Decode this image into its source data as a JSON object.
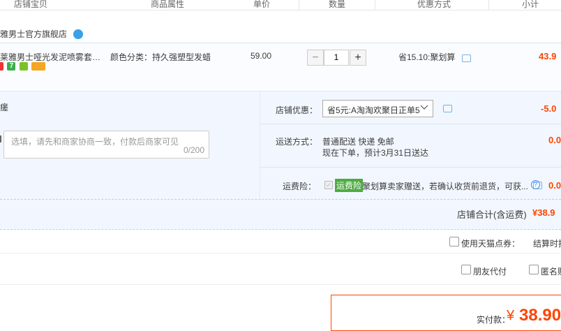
{
  "header": {
    "col_item": "店铺宝贝",
    "col_attr": "商品属性",
    "col_price": "单价",
    "col_qty": "数量",
    "col_promo": "优惠方式",
    "col_subtotal": "小计"
  },
  "shop": {
    "name": "雅男士官方旗舰店"
  },
  "item": {
    "title": "莱雅男士哑光发泥喷雾套装持...",
    "sku_label": "颜色分类：",
    "sku_value": "持久强塑型发蜡",
    "price": "59.00",
    "quantity": "1",
    "minus": "−",
    "plus": "+",
    "promo": "省15.10:聚划算",
    "subtotal": "43.9",
    "badges": [
      {
        "name": "badge-red-icon",
        "color": "#e33"
      },
      {
        "name": "badge-7-icon",
        "color": "#3cb04a",
        "text": "7"
      },
      {
        "name": "badge-green-icon",
        "color": "#7cc12a"
      },
      {
        "name": "badge-card-icon",
        "color": "#f5a623"
      }
    ]
  },
  "left_panel": {
    "label_fragment": "瘥",
    "message_placeholder": "选填，请先和商家协商一致，付款后商家可见",
    "message_counter": "0/200"
  },
  "shop_discount": {
    "label": "店铺优惠：",
    "selected": "省5元:A淘淘欢聚日正单5",
    "amount": "-5.0"
  },
  "shipping": {
    "label": "运送方式：",
    "method": "普通配送 快递 免邮",
    "eta": "现在下单，预计3月31日送达",
    "amount": "0.0"
  },
  "insurance": {
    "label": "运费险：",
    "tag": "运费险",
    "desc": "聚划算卖家赠送，若确认收货前退货，可获...",
    "amount": "0.0",
    "checkmark": "✓",
    "help": "?"
  },
  "summary": {
    "label": "店铺合计(含运费)",
    "amount": "¥38.9"
  },
  "options": {
    "tmall_points": "使用天猫点券：",
    "settle_fragment": "结算时抵",
    "friend_pay": "朋友代付",
    "anonymous": "匿名购"
  },
  "payment": {
    "label": "实付款：",
    "currency": "¥",
    "amount": "38.90"
  },
  "colors": {
    "accent_red": "#ff4400",
    "panel_blue": "#f2f7ff",
    "insurance_green": "#4eab42"
  }
}
